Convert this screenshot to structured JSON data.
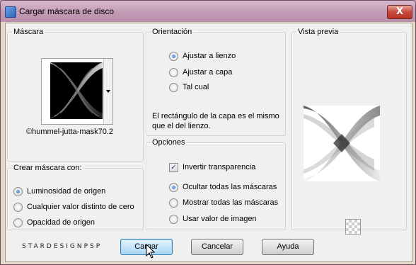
{
  "window": {
    "title": "Cargar máscara de disco",
    "close_glyph": "X"
  },
  "mask_group": {
    "legend": "Máscara",
    "file_name": "©hummel-jutta-mask70.2"
  },
  "orientation": {
    "legend": "Orientación",
    "options": [
      "Ajustar a lienzo",
      "Ajustar a capa",
      "Tal cual"
    ],
    "selected_index": 0,
    "note": "El rectángulo de la capa es el mismo que el del lienzo."
  },
  "create_mask": {
    "legend": "Crear máscara con:",
    "options": [
      "Luminosidad de origen",
      "Cualquier valor distinto de cero",
      "Opacidad de origen"
    ],
    "selected_index": 0
  },
  "opciones": {
    "legend": "Opciones",
    "invert_label": "Invertir transparencia",
    "invert_checked": true,
    "options": [
      "Ocultar todas las máscaras",
      "Mostrar todas las máscaras",
      "Usar valor de imagen"
    ],
    "selected_index": 0
  },
  "preview": {
    "legend": "Vista previa",
    "zoom_icon": "checkerboard-icon"
  },
  "footer": {
    "signature": "STARDESIGNPSP"
  },
  "buttons": {
    "load": "Cargar",
    "cancel": "Cancelar",
    "help": "Ayuda"
  },
  "colors": {
    "title_bar": "#c29bb5",
    "close": "#c8493c",
    "accent": "#1e5cb0"
  }
}
